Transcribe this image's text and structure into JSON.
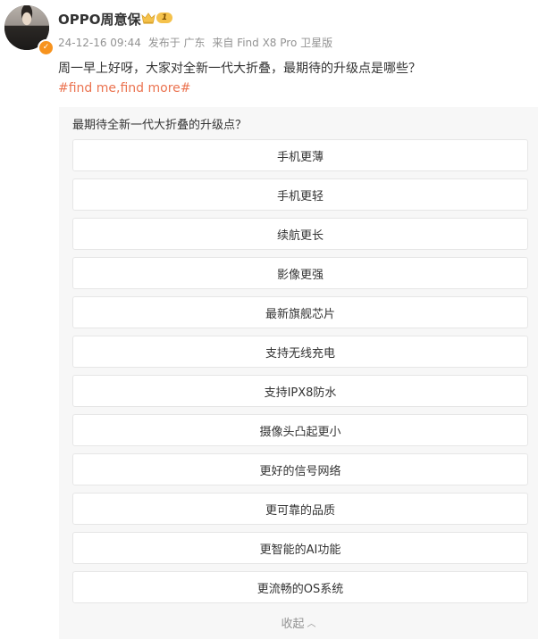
{
  "post": {
    "username": "OPPO周意保",
    "badge_level": "1",
    "date": "24-12-16 09:44",
    "location": "发布于 广东",
    "source": "来自 Find X8 Pro 卫星版",
    "text": "周一早上好呀，大家对全新一代大折叠，最期待的升级点是哪些？",
    "hashtag": "#find me,find more#"
  },
  "poll": {
    "title": "最期待全新一代大折叠的升级点？",
    "options": [
      "手机更薄",
      "手机更轻",
      "续航更长",
      "影像更强",
      "最新旗舰芯片",
      "支持无线充电",
      "支持IPX8防水",
      "摄像头凸起更小",
      "更好的信号网络",
      "更可靠的品质",
      "更智能的AI功能",
      "更流畅的OS系统"
    ],
    "collapse_label": "收起",
    "collapse_icon": "chevron-up-icon"
  },
  "colors": {
    "hashtag": "#eb7350",
    "meta": "#939393",
    "poll_bg": "#f7f7f7",
    "badge": "#f5c24c",
    "verified": "#f7931e"
  }
}
